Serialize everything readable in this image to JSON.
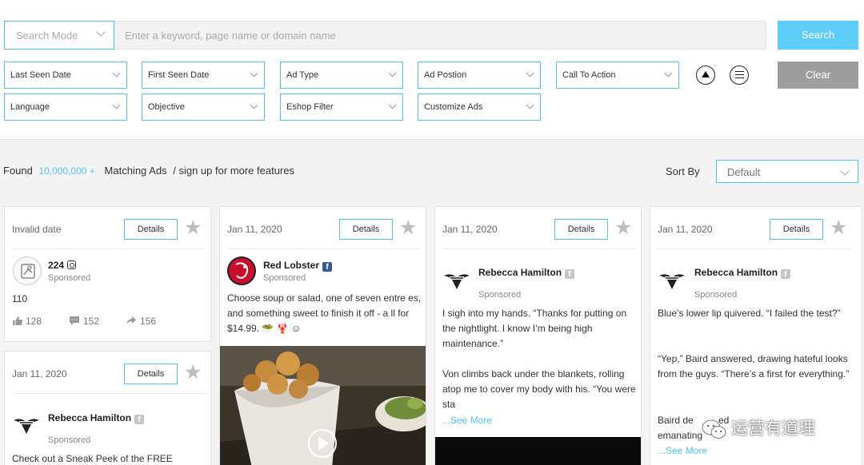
{
  "filters": {
    "search_mode": "Search Mode",
    "search_placeholder": "Enter a keyword, page name or domain name",
    "search_button": "Search",
    "clear_button": "Clear",
    "row1": [
      "Last Seen Date",
      "First Seen Date",
      "Ad Type",
      "Ad Postion",
      "Call To Action"
    ],
    "row2": [
      "Language",
      "Objective",
      "Eshop Filter",
      "Customize Ads"
    ]
  },
  "results": {
    "found_label": "Found",
    "count": "10,000,000 +",
    "matching": "Matching Ads",
    "separator": "/",
    "signup": "sign up",
    "more": "for more features",
    "sort_label": "Sort By",
    "sort_value": "Default"
  },
  "cards": {
    "details_label": "Details",
    "sponsored_label": "Sponsored",
    "see_more": "...See More",
    "c1": {
      "date": "Invalid date",
      "name": "224",
      "text": "110",
      "likes": "128",
      "comments": "152",
      "shares": "156"
    },
    "c2": {
      "date": "Jan 11, 2020",
      "name": "Rebecca Hamilton",
      "text": "Check out a Sneak Peek of the FREE"
    },
    "c3": {
      "date": "Jan 11, 2020",
      "name": "Red Lobster",
      "text": "Choose soup or salad, one of seven entre es, and something sweet to finish it off - a ll for $14.99. 🥗 🦞 ☺"
    },
    "c4": {
      "date": "Jan 11, 2020",
      "name": "Rebecca Hamilton",
      "text1": "I sigh into my hands. “Thanks for putting on the nightlight. I know I’m being high maintenance.”",
      "text2": "Von climbs back under the blankets, rolling atop me to cover my body with his. “You were sta"
    },
    "c5": {
      "date": "Jan 11, 2020",
      "name": "Rebecca Hamilton",
      "text1": "Blue’s lower lip quivered. “I failed the test?”",
      "text2": "“Yep,” Baird answered, drawing hateful looks from the guys. “There’s a first for everything.”",
      "text3": "Baird de",
      "text3b": "ed",
      "text4": "emanating"
    }
  },
  "watermark": "运营有道理",
  "colors": {
    "accent": "#4fc3f7",
    "search_btn": "#5fcdfa",
    "clear_btn": "#9e9e9e"
  }
}
